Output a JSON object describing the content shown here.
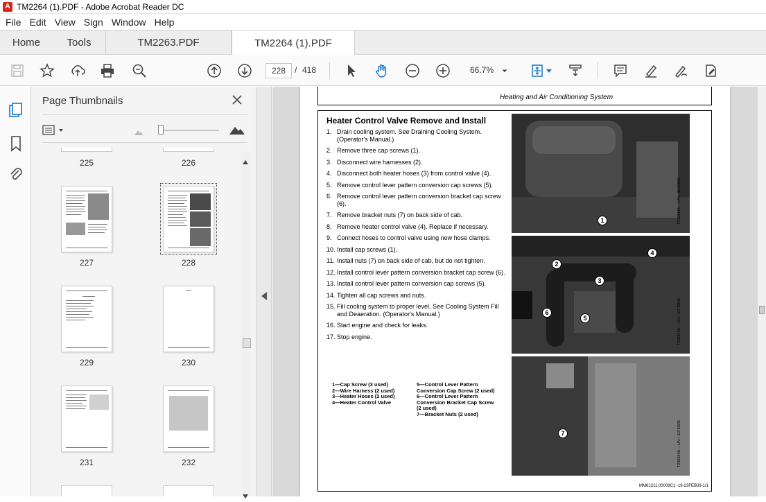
{
  "window": {
    "title": "TM2264 (1).PDF - Adobe Acrobat Reader DC"
  },
  "menu": [
    "File",
    "Edit",
    "View",
    "Sign",
    "Window",
    "Help"
  ],
  "tabs": {
    "home": "Home",
    "tools": "Tools",
    "doc1": "TM2263.PDF",
    "doc2": "TM2264 (1).PDF"
  },
  "toolbar": {
    "current_page": "228",
    "page_sep": "/",
    "total_pages": "418",
    "zoom": "66.7%",
    "icons": [
      "save-icon",
      "bookmark-star-icon",
      "upload-icon",
      "print-icon",
      "search-zoom-icon",
      "page-up-icon",
      "page-down-icon",
      "select-cursor-icon",
      "hand-tool-icon",
      "zoom-out-icon",
      "zoom-in-icon",
      "zoom-dropdown-icon",
      "fit-page-icon",
      "scroll-mode-icon",
      "comment-icon",
      "highlight-icon",
      "draw-icon",
      "fill-sign-icon"
    ]
  },
  "sidebar": {
    "panel_title": "Page Thumbnails",
    "thumbs": [
      {
        "num": "225"
      },
      {
        "num": "226"
      },
      {
        "num": "227"
      },
      {
        "num": "228",
        "selected": true
      },
      {
        "num": "229"
      },
      {
        "num": "230"
      },
      {
        "num": "231"
      },
      {
        "num": "232"
      }
    ]
  },
  "document": {
    "header": "Heating and Air Conditioning System",
    "section_title": "Heater Control Valve Remove and Install",
    "steps": [
      {
        "n": "1.",
        "text": "Drain cooling system. See Draining Cooling System. (Operator's Manual.)"
      },
      {
        "n": "2.",
        "text": "Remove three cap screws (1)."
      },
      {
        "n": "3.",
        "text": "Disconnect wire harnesses (2)."
      },
      {
        "n": "4.",
        "text": "Disconnect both heater hoses (3) from control valve (4)."
      },
      {
        "n": "5.",
        "text": "Remove control lever pattern conversion cap screws (5)."
      },
      {
        "n": "6.",
        "text": "Remove control lever pattern conversion bracket cap screw (6)."
      },
      {
        "n": "7.",
        "text": "Remove bracket nuts (7) on back side of cab."
      },
      {
        "n": "8.",
        "text": "Remove heater control valve (4). Replace if necessary."
      },
      {
        "n": "9.",
        "text": "Connect hoses to control valve using new hose clamps."
      },
      {
        "n": "10.",
        "text": "Install cap screws (1)."
      },
      {
        "n": "11.",
        "text": "Install nuts (7) on back side of cab, but do not tighten."
      },
      {
        "n": "12.",
        "text": "Install control lever pattern conversion bracket cap screw (6)."
      },
      {
        "n": "13.",
        "text": "Install control lever pattern conversion cap screws (5)."
      },
      {
        "n": "14.",
        "text": "Tighten all cap screws and nuts."
      },
      {
        "n": "15.",
        "text": "Fill cooling system to proper level. See Cooling System Fill and Deaeration. (Operator's Manual.)"
      },
      {
        "n": "16.",
        "text": "Start engine and check for leaks."
      },
      {
        "n": "17.",
        "text": "Stop engine."
      }
    ],
    "legend_left": [
      "1—Cap Screw (3 used)",
      "2—Wire Harness (2 used)",
      "3—Heater Hoses (2 used)",
      "4—Heater Control Valve"
    ],
    "legend_right": [
      "5—Control Lever Pattern Conversion Cap Screw (2 used)",
      "6—Control Lever Pattern Conversion Bracket Cap Screw (2 used)",
      "7—Bracket Nuts (2 used)"
    ],
    "photo_codes": [
      "T230344A —UN—11FEB05",
      "T230345A —UN—11FEB05",
      "T230346A —UN—11FEB05"
    ],
    "footer_ref": "MM61211,00008C1 -19-23FEB09-1/1"
  }
}
